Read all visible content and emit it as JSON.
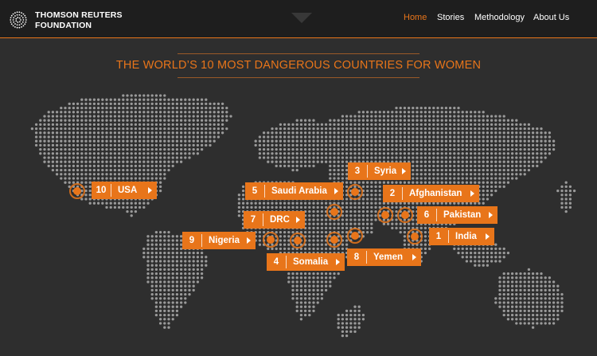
{
  "brand": {
    "line1": "THOMSON REUTERS",
    "line2": "FOUNDATION"
  },
  "nav": {
    "items": [
      {
        "label": "Home",
        "active": true
      },
      {
        "label": "Stories",
        "active": false
      },
      {
        "label": "Methodology",
        "active": false
      },
      {
        "label": "About Us",
        "active": false
      }
    ]
  },
  "page": {
    "title": "THE WORLD’S 10 MOST DANGEROUS COUNTRIES FOR WOMEN"
  },
  "colors": {
    "accent": "#e8751a",
    "background": "#2e2e2e",
    "header": "#1e1e1e",
    "map_dots": "#9a9a9a"
  },
  "countries": [
    {
      "rank": "1",
      "name": "India"
    },
    {
      "rank": "2",
      "name": "Afghanistan"
    },
    {
      "rank": "3",
      "name": "Syria"
    },
    {
      "rank": "4",
      "name": "Somalia"
    },
    {
      "rank": "5",
      "name": "Saudi Arabia"
    },
    {
      "rank": "6",
      "name": "Pakistan"
    },
    {
      "rank": "7",
      "name": "DRC"
    },
    {
      "rank": "8",
      "name": "Yemen"
    },
    {
      "rank": "9",
      "name": "Nigeria"
    },
    {
      "rank": "10",
      "name": "USA"
    }
  ]
}
